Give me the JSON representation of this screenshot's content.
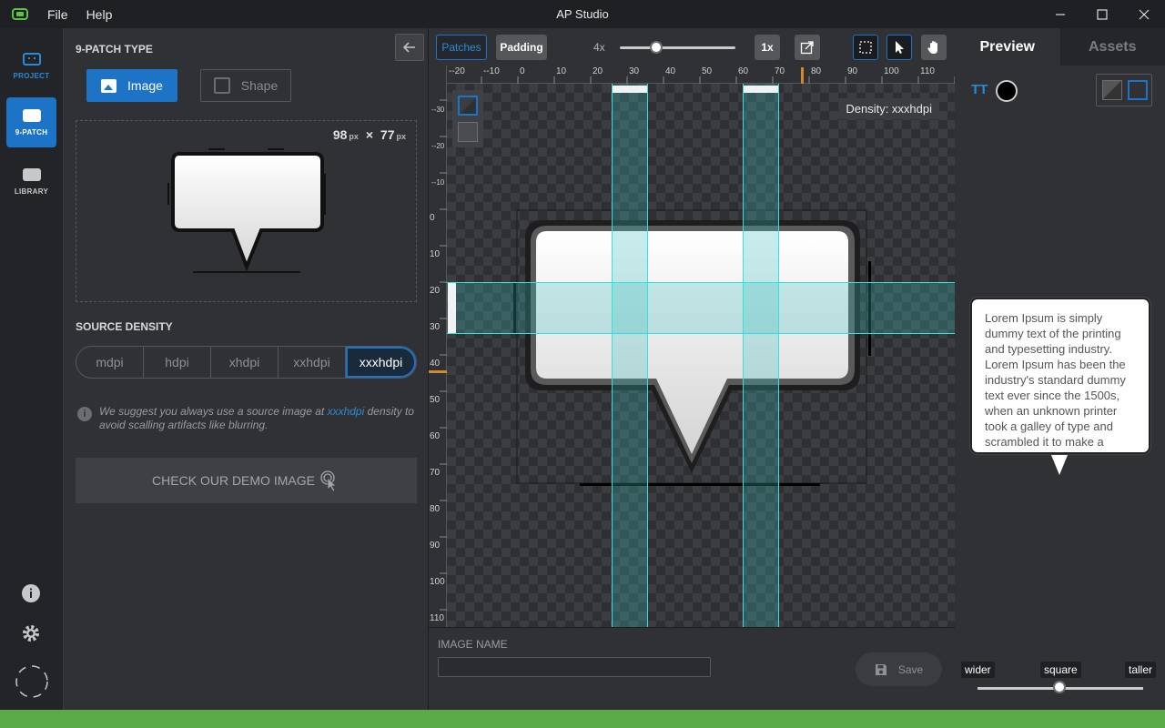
{
  "app": {
    "title": "AP Studio",
    "menu": [
      "File",
      "Help"
    ]
  },
  "nav": {
    "project": "PROJECT",
    "ninepatch": "9-PATCH",
    "library": "LIBRARY"
  },
  "left": {
    "type_title": "9-PATCH TYPE",
    "image_label": "Image",
    "shape_label": "Shape",
    "width": "98",
    "height": "77",
    "unit": "px",
    "times": "×",
    "density_title": "SOURCE DENSITY",
    "densities": [
      "mdpi",
      "hdpi",
      "xhdpi",
      "xxhdpi",
      "xxxhdpi"
    ],
    "selected_density": "xxxhdpi",
    "hint_pre": "We suggest you always use a source image at ",
    "hint_highlight": "xxxhdpi",
    "hint_post": " density to avoid scalling artifacts like blurring.",
    "demo_label": "CHECK OUR DEMO IMAGE"
  },
  "editor": {
    "patches_label": "Patches",
    "padding_label": "Padding",
    "zoom": "4x",
    "zoom_level": 0.34,
    "reset_zoom": "1x",
    "density_badge": "Density: xxxhdpi",
    "ruler_h": [
      "--20",
      "--10",
      "0",
      "10",
      "20",
      "30",
      "40",
      "50",
      "60",
      "70",
      "80",
      "90",
      "100",
      "110"
    ],
    "ruler_v": [
      "--30",
      "--20",
      "--10",
      "0",
      "10",
      "20",
      "30",
      "40",
      "50",
      "60",
      "70",
      "80",
      "90",
      "100",
      "110"
    ],
    "image_name_label": "IMAGE NAME",
    "image_name_value": "",
    "save_label": "Save"
  },
  "right": {
    "tab_preview": "Preview",
    "tab_assets": "Assets",
    "font_icon": "TT",
    "text_color": "#000000",
    "bubble_text": "Lorem Ipsum is simply dummy text of the printing and typesetting industry. Lorem Ipsum has been the industry's standard dummy text ever since the 1500s, when an unknown printer took a galley of type and scrambled it to make a",
    "ratio_wider": "wider",
    "ratio_square": "square",
    "ratio_taller": "taller",
    "ratio_level": 0.5
  },
  "colors": {
    "accent": "#1d74c6",
    "patch_cyan": "#35e0e0",
    "status_green": "#5aab47"
  }
}
